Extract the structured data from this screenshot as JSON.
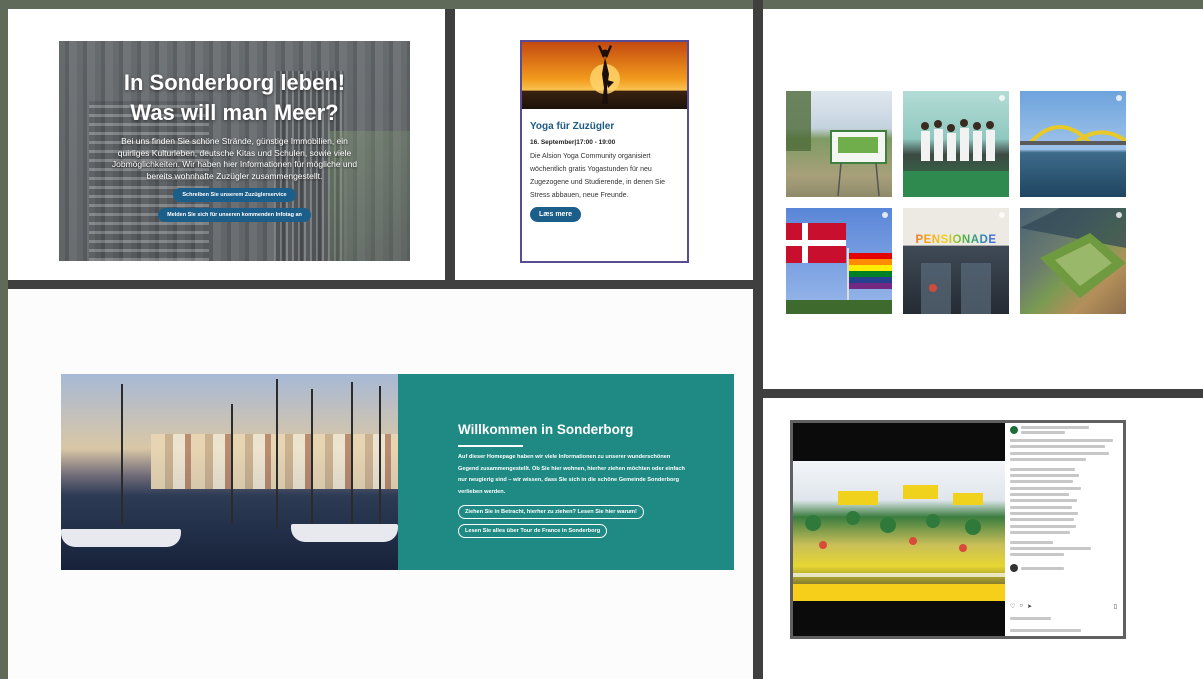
{
  "hero": {
    "title_line1": "In Sonderborg leben!",
    "title_line2": "Was will man Meer?",
    "description": "Bei uns finden Sie schöne Strände, günstige Immobilien, ein quirliges Kulturleben, deutsche Kitas und Schulen, sowie viele Jobmöglichkeiten. Wir haben hier Informationen für mögliche und bereits wohnhafte Zuzügler zusammengestellt.",
    "button1": "Schreiben Sie unserem Zuzüglerservice",
    "button2": "Melden Sie sich für unseren kommenden Infotag an"
  },
  "event": {
    "title": "Yoga für Zuzügler",
    "date": "16. September|17:00 - 19:00",
    "description": "Die Alsion Yoga Community organisiert wöchentlich gratis Yogastunden für neu Zugezogene und Studierende, in denen Sie Stress abbauen, neue Freunde.",
    "button": "Læs mere"
  },
  "photos": {
    "pensionade_text": "PENSIONADE"
  },
  "welcome": {
    "title": "Willkommen in Sonderborg",
    "text": "Auf dieser Homepage haben wir viele Informationen zu unserer wunderschönen Gegend zusammengestellt. Ob Sie hier wohnen, hierher ziehen möchten oder einfach nur neugierig sind – wir wissen, dass Sie sich in die schöne Gemeinde Sonderborg verlieben werden.",
    "button1": "Ziehen Sie in Betracht, hierher zu ziehen? Lesen Sie hier warum!",
    "button2": "Lesen Sie alles über Tour de France in Sonderborg"
  },
  "colors": {
    "background": "#5f6b58",
    "accent_blue": "#1c5e8a",
    "teal": "#1f8a84",
    "card_border": "#5a4c93"
  }
}
